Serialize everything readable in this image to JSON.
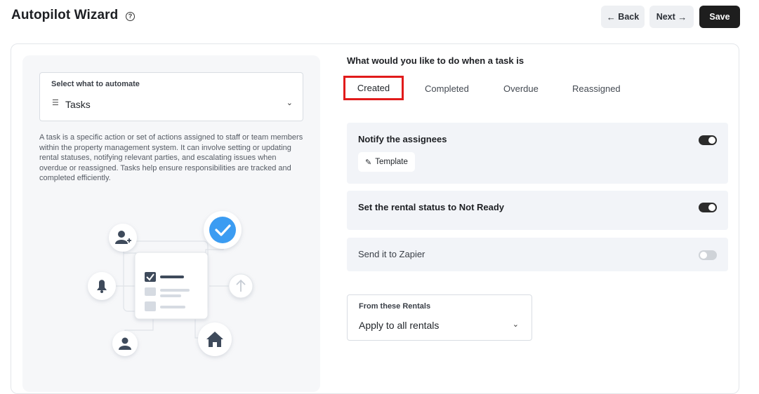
{
  "header": {
    "title": "Autopilot Wizard",
    "help_icon": "question-circle-icon",
    "back_label": "Back",
    "next_label": "Next",
    "save_label": "Save"
  },
  "automate": {
    "label": "Select what to automate",
    "value": "Tasks",
    "icon": "list-icon",
    "description": "A task is a specific action or set of actions assigned to staff or team members within the property management system. It can involve setting or updating rental statuses, notifying relevant parties, and escalating issues when overdue or reassigned. Tasks help ensure responsibilities are tracked and completed efficiently."
  },
  "trigger": {
    "question": "What would you like to do when a task is",
    "tabs": [
      "Created",
      "Completed",
      "Overdue",
      "Reassigned"
    ],
    "active_tab": "Created"
  },
  "actions": [
    {
      "title": "Notify the assignees",
      "enabled": true,
      "button_label": "Template"
    },
    {
      "title": "Set the rental status to Not Ready",
      "enabled": true
    },
    {
      "title": "Send it to Zapier",
      "enabled": false
    }
  ],
  "rentals": {
    "label": "From these Rentals",
    "value": "Apply to all rentals"
  },
  "colors": {
    "accent_dark": "#1e1e1e",
    "highlight_red": "#e11b1b",
    "check_blue": "#3b9cf2",
    "panel_bg": "#f6f7f9",
    "option_bg": "#f2f4f8"
  }
}
